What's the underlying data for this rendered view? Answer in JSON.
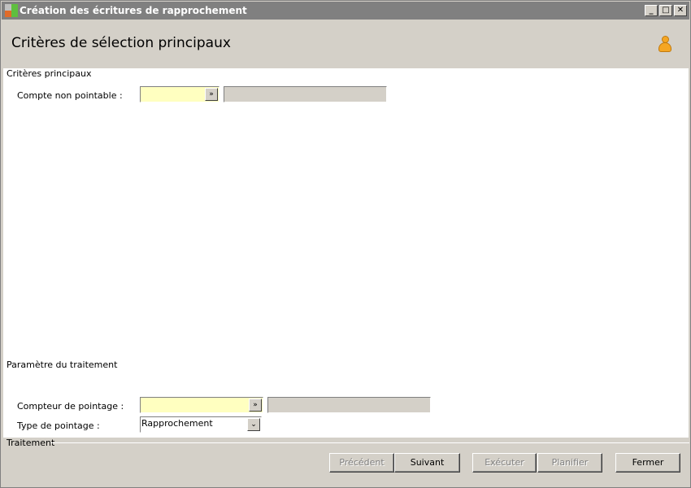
{
  "window": {
    "title": "Création des écritures de rapprochement",
    "minimize_label": "_",
    "maximize_label": "□",
    "close_label": "✕"
  },
  "header": {
    "title": "Critères de sélection principaux"
  },
  "main_criteria": {
    "group_label": "Critères principaux",
    "compte_label": "Compte non pointable :",
    "compte_value": "",
    "compte_description": ""
  },
  "processing_params": {
    "group_label": "Paramètre du traitement",
    "compteur_label": "Compteur de pointage :",
    "compteur_value": "",
    "compteur_description": "",
    "type_label": "Type de pointage :",
    "type_value": "Rapprochement"
  },
  "footer": {
    "group_label": "Traitement",
    "buttons": {
      "precedent": "Précédent",
      "suivant": "Suivant",
      "executer": "Exécuter",
      "planifier": "Planifier",
      "fermer": "Fermer"
    }
  },
  "colors": {
    "title_bar": "#808080",
    "required_field": "#ffffc0",
    "user_icon": "#f5a623"
  }
}
